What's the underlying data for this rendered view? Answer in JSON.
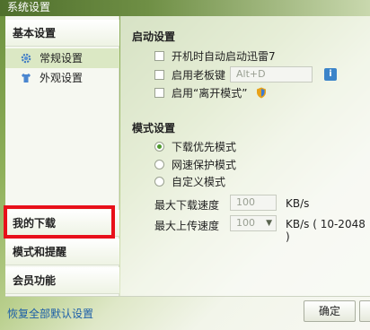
{
  "window": {
    "title": "系统设置"
  },
  "sidebar": {
    "basic_header": "基本设置",
    "items": [
      {
        "label": "常规设置",
        "icon": "gear-icon",
        "active": true
      },
      {
        "label": "外观设置",
        "icon": "shirt-icon",
        "active": false
      }
    ],
    "my_downloads": "我的下载",
    "mode_reminders": "模式和提醒",
    "member": "会员功能"
  },
  "startup": {
    "title": "启动设置",
    "autostart_label": "开机时自动启动迅雷7",
    "boss_key_label": "启用老板键",
    "boss_key_value": "Alt+D",
    "away_mode_label": "启用“离开模式”"
  },
  "mode": {
    "title": "模式设置",
    "options": [
      "下载优先模式",
      "网速保护模式",
      "自定义模式"
    ],
    "selected_index": 0,
    "max_download_label": "最大下载速度",
    "max_download_value": "100",
    "max_download_unit": "KB/s",
    "max_upload_label": "最大上传速度",
    "max_upload_value": "100",
    "max_upload_unit": "KB/s ( 10-2048 )"
  },
  "footer": {
    "restore_link": "恢复全部默认设置",
    "ok_button": "确定"
  },
  "colors": {
    "highlight_box": "#e8101a",
    "link": "#1b5ea8",
    "active_item_bg": "#dbe8c4"
  }
}
